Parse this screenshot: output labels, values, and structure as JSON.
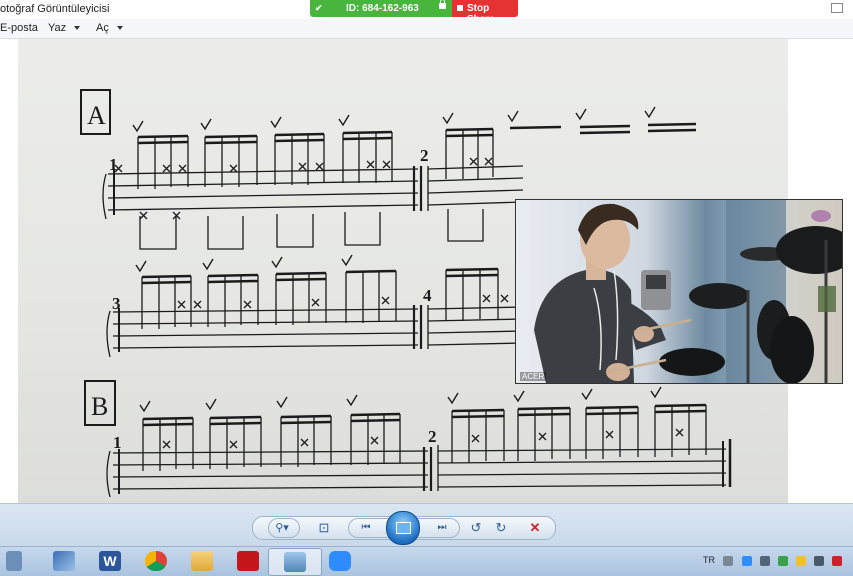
{
  "window": {
    "title": "otoğraf Görüntüleyicisi"
  },
  "share_bar": {
    "meeting_id": "ID: 684-162-963",
    "stop_label": "Stop Share"
  },
  "menu": {
    "items": [
      "E-posta",
      "Yaz",
      "Aç"
    ]
  },
  "camera": {
    "label": "ACER"
  },
  "sheet": {
    "section_a": "A",
    "section_b": "B",
    "measures": [
      "1",
      "2",
      "3",
      "4",
      "1",
      "2"
    ]
  },
  "toolbar": {
    "buttons": [
      "zoom",
      "actual-size",
      "previous",
      "slideshow",
      "next",
      "rotate-left",
      "rotate-right",
      "delete"
    ]
  },
  "taskbar": {
    "apps": [
      "windows-explorer-window",
      "word",
      "chrome",
      "file-explorer",
      "acrobat",
      "photo-viewer",
      "zoom"
    ],
    "tray_language": "TR"
  }
}
